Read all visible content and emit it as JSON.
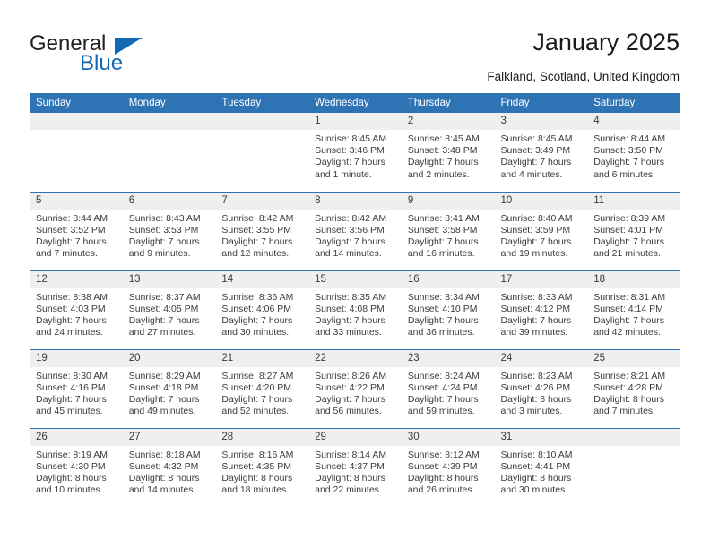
{
  "brand": {
    "name_part1": "General",
    "name_part2": "Blue",
    "accent_color": "#1268b3"
  },
  "header": {
    "title": "January 2025",
    "location": "Falkland, Scotland, United Kingdom",
    "header_bg": "#2e74b5"
  },
  "weekdays": [
    "Sunday",
    "Monday",
    "Tuesday",
    "Wednesday",
    "Thursday",
    "Friday",
    "Saturday"
  ],
  "weeks": [
    [
      {
        "empty": true
      },
      {
        "empty": true
      },
      {
        "empty": true
      },
      {
        "day": "1",
        "sunrise": "Sunrise: 8:45 AM",
        "sunset": "Sunset: 3:46 PM",
        "daylight1": "Daylight: 7 hours",
        "daylight2": "and 1 minute."
      },
      {
        "day": "2",
        "sunrise": "Sunrise: 8:45 AM",
        "sunset": "Sunset: 3:48 PM",
        "daylight1": "Daylight: 7 hours",
        "daylight2": "and 2 minutes."
      },
      {
        "day": "3",
        "sunrise": "Sunrise: 8:45 AM",
        "sunset": "Sunset: 3:49 PM",
        "daylight1": "Daylight: 7 hours",
        "daylight2": "and 4 minutes."
      },
      {
        "day": "4",
        "sunrise": "Sunrise: 8:44 AM",
        "sunset": "Sunset: 3:50 PM",
        "daylight1": "Daylight: 7 hours",
        "daylight2": "and 6 minutes."
      }
    ],
    [
      {
        "day": "5",
        "sunrise": "Sunrise: 8:44 AM",
        "sunset": "Sunset: 3:52 PM",
        "daylight1": "Daylight: 7 hours",
        "daylight2": "and 7 minutes."
      },
      {
        "day": "6",
        "sunrise": "Sunrise: 8:43 AM",
        "sunset": "Sunset: 3:53 PM",
        "daylight1": "Daylight: 7 hours",
        "daylight2": "and 9 minutes."
      },
      {
        "day": "7",
        "sunrise": "Sunrise: 8:42 AM",
        "sunset": "Sunset: 3:55 PM",
        "daylight1": "Daylight: 7 hours",
        "daylight2": "and 12 minutes."
      },
      {
        "day": "8",
        "sunrise": "Sunrise: 8:42 AM",
        "sunset": "Sunset: 3:56 PM",
        "daylight1": "Daylight: 7 hours",
        "daylight2": "and 14 minutes."
      },
      {
        "day": "9",
        "sunrise": "Sunrise: 8:41 AM",
        "sunset": "Sunset: 3:58 PM",
        "daylight1": "Daylight: 7 hours",
        "daylight2": "and 16 minutes."
      },
      {
        "day": "10",
        "sunrise": "Sunrise: 8:40 AM",
        "sunset": "Sunset: 3:59 PM",
        "daylight1": "Daylight: 7 hours",
        "daylight2": "and 19 minutes."
      },
      {
        "day": "11",
        "sunrise": "Sunrise: 8:39 AM",
        "sunset": "Sunset: 4:01 PM",
        "daylight1": "Daylight: 7 hours",
        "daylight2": "and 21 minutes."
      }
    ],
    [
      {
        "day": "12",
        "sunrise": "Sunrise: 8:38 AM",
        "sunset": "Sunset: 4:03 PM",
        "daylight1": "Daylight: 7 hours",
        "daylight2": "and 24 minutes."
      },
      {
        "day": "13",
        "sunrise": "Sunrise: 8:37 AM",
        "sunset": "Sunset: 4:05 PM",
        "daylight1": "Daylight: 7 hours",
        "daylight2": "and 27 minutes."
      },
      {
        "day": "14",
        "sunrise": "Sunrise: 8:36 AM",
        "sunset": "Sunset: 4:06 PM",
        "daylight1": "Daylight: 7 hours",
        "daylight2": "and 30 minutes."
      },
      {
        "day": "15",
        "sunrise": "Sunrise: 8:35 AM",
        "sunset": "Sunset: 4:08 PM",
        "daylight1": "Daylight: 7 hours",
        "daylight2": "and 33 minutes."
      },
      {
        "day": "16",
        "sunrise": "Sunrise: 8:34 AM",
        "sunset": "Sunset: 4:10 PM",
        "daylight1": "Daylight: 7 hours",
        "daylight2": "and 36 minutes."
      },
      {
        "day": "17",
        "sunrise": "Sunrise: 8:33 AM",
        "sunset": "Sunset: 4:12 PM",
        "daylight1": "Daylight: 7 hours",
        "daylight2": "and 39 minutes."
      },
      {
        "day": "18",
        "sunrise": "Sunrise: 8:31 AM",
        "sunset": "Sunset: 4:14 PM",
        "daylight1": "Daylight: 7 hours",
        "daylight2": "and 42 minutes."
      }
    ],
    [
      {
        "day": "19",
        "sunrise": "Sunrise: 8:30 AM",
        "sunset": "Sunset: 4:16 PM",
        "daylight1": "Daylight: 7 hours",
        "daylight2": "and 45 minutes."
      },
      {
        "day": "20",
        "sunrise": "Sunrise: 8:29 AM",
        "sunset": "Sunset: 4:18 PM",
        "daylight1": "Daylight: 7 hours",
        "daylight2": "and 49 minutes."
      },
      {
        "day": "21",
        "sunrise": "Sunrise: 8:27 AM",
        "sunset": "Sunset: 4:20 PM",
        "daylight1": "Daylight: 7 hours",
        "daylight2": "and 52 minutes."
      },
      {
        "day": "22",
        "sunrise": "Sunrise: 8:26 AM",
        "sunset": "Sunset: 4:22 PM",
        "daylight1": "Daylight: 7 hours",
        "daylight2": "and 56 minutes."
      },
      {
        "day": "23",
        "sunrise": "Sunrise: 8:24 AM",
        "sunset": "Sunset: 4:24 PM",
        "daylight1": "Daylight: 7 hours",
        "daylight2": "and 59 minutes."
      },
      {
        "day": "24",
        "sunrise": "Sunrise: 8:23 AM",
        "sunset": "Sunset: 4:26 PM",
        "daylight1": "Daylight: 8 hours",
        "daylight2": "and 3 minutes."
      },
      {
        "day": "25",
        "sunrise": "Sunrise: 8:21 AM",
        "sunset": "Sunset: 4:28 PM",
        "daylight1": "Daylight: 8 hours",
        "daylight2": "and 7 minutes."
      }
    ],
    [
      {
        "day": "26",
        "sunrise": "Sunrise: 8:19 AM",
        "sunset": "Sunset: 4:30 PM",
        "daylight1": "Daylight: 8 hours",
        "daylight2": "and 10 minutes."
      },
      {
        "day": "27",
        "sunrise": "Sunrise: 8:18 AM",
        "sunset": "Sunset: 4:32 PM",
        "daylight1": "Daylight: 8 hours",
        "daylight2": "and 14 minutes."
      },
      {
        "day": "28",
        "sunrise": "Sunrise: 8:16 AM",
        "sunset": "Sunset: 4:35 PM",
        "daylight1": "Daylight: 8 hours",
        "daylight2": "and 18 minutes."
      },
      {
        "day": "29",
        "sunrise": "Sunrise: 8:14 AM",
        "sunset": "Sunset: 4:37 PM",
        "daylight1": "Daylight: 8 hours",
        "daylight2": "and 22 minutes."
      },
      {
        "day": "30",
        "sunrise": "Sunrise: 8:12 AM",
        "sunset": "Sunset: 4:39 PM",
        "daylight1": "Daylight: 8 hours",
        "daylight2": "and 26 minutes."
      },
      {
        "day": "31",
        "sunrise": "Sunrise: 8:10 AM",
        "sunset": "Sunset: 4:41 PM",
        "daylight1": "Daylight: 8 hours",
        "daylight2": "and 30 minutes."
      },
      {
        "empty": true
      }
    ]
  ]
}
